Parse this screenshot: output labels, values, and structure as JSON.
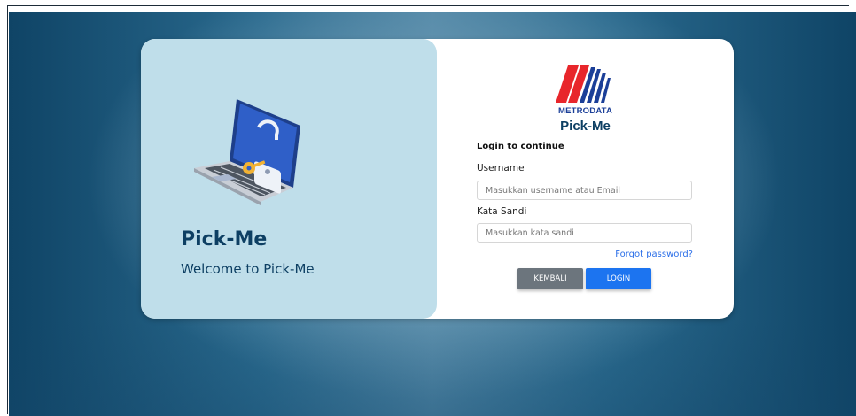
{
  "left_panel": {
    "title": "Pick-Me",
    "subtitle": "Welcome to Pick-Me",
    "illustration_icon": "laptop-lock-key-icon"
  },
  "right_panel": {
    "logo_text": "METRODATA",
    "app_name": "Pick-Me",
    "heading": "Login to continue",
    "username_label": "Username",
    "username_placeholder": "Masukkan username atau Email",
    "password_label": "Kata Sandi",
    "password_placeholder": "Masukkan kata sandi",
    "forgot_link": "Forgot password?",
    "back_button": "KEMBALI",
    "login_button": "LOGIN"
  },
  "colors": {
    "brand_dark": "#0d3f63",
    "left_panel_bg": "#bfdeea",
    "login_button": "#1c74f0",
    "back_button": "#6c757d",
    "logo_red": "#e8262b",
    "logo_blue": "#1b3f98"
  }
}
